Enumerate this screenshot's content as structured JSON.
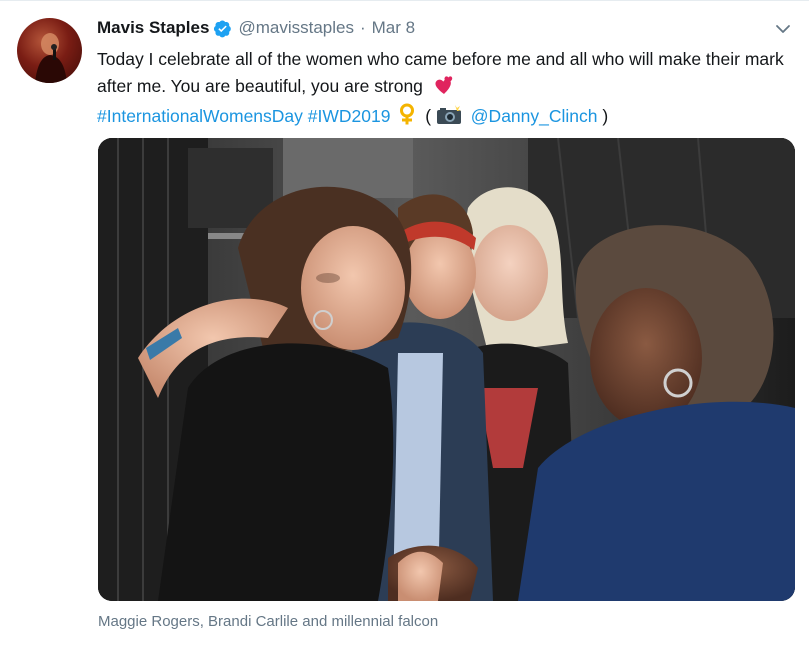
{
  "tweet": {
    "display_name": "Mavis Staples",
    "handle": "@mavisstaples",
    "separator": "·",
    "date": "Mar 8",
    "text_line": "Today I celebrate all of the women who came before me and all who will make their mark after me. You are beautiful, you are strong",
    "hashtag_1": "#InternationalWomensDay",
    "hashtag_2": "#IWD2019",
    "paren_open": "(",
    "mention": "@Danny_Clinch",
    "paren_close": ")",
    "caption": "Maggie Rogers, Brandi Carlile and millennial falcon"
  },
  "icons": {
    "verified": "verified-badge-icon",
    "caret": "chevron-down-icon",
    "heart_emoji": "two-hearts-emoji",
    "female_emoji": "female-sign-emoji",
    "camera_emoji": "camera-with-flash-emoji"
  },
  "colors": {
    "link": "#1b95e0",
    "text": "#14171a",
    "secondary": "#657786",
    "verified": "#1da1f2"
  }
}
